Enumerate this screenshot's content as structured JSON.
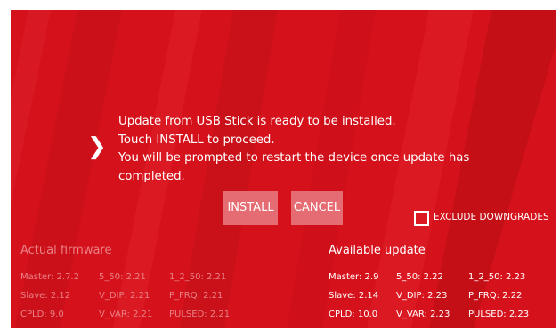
{
  "message": {
    "lines": [
      "Update from USB Stick is ready to be installed.",
      "Touch INSTALL to proceed.",
      "You will be prompted to restart the device once update has",
      "completed."
    ]
  },
  "icons": {
    "proceed": "chevron-right-icon",
    "checkbox": "checkbox-unchecked-icon"
  },
  "buttons": {
    "install": "INSTALL",
    "cancel": "CANCEL"
  },
  "options": {
    "exclude_downgrades": {
      "label": "EXCLUDE DOWNGRADES",
      "checked": false
    }
  },
  "actual": {
    "title": "Actual firmware",
    "rows": [
      [
        "Master: 2.7.2",
        "5_50: 2.21",
        "1_2_50: 2.21"
      ],
      [
        "Slave: 2.12",
        "V_DIP: 2.21",
        "P_FRQ: 2.21"
      ],
      [
        "CPLD: 9.0",
        "V_VAR: 2.21",
        "PULSED: 2.21"
      ]
    ]
  },
  "available": {
    "title": "Available update",
    "rows": [
      [
        "Master: 2.9",
        "5_50: 2.22",
        "1_2_50: 2.23"
      ],
      [
        "Slave: 2.14",
        "V_DIP: 2.23",
        "P_FRQ: 2.22"
      ],
      [
        "CPLD: 10.0",
        "V_VAR: 2.23",
        "PULSED: 2.23"
      ]
    ]
  },
  "colors": {
    "background": "#d5121b",
    "button": "#e56c72",
    "muted_text": "#e98186",
    "text": "#ffffff"
  }
}
